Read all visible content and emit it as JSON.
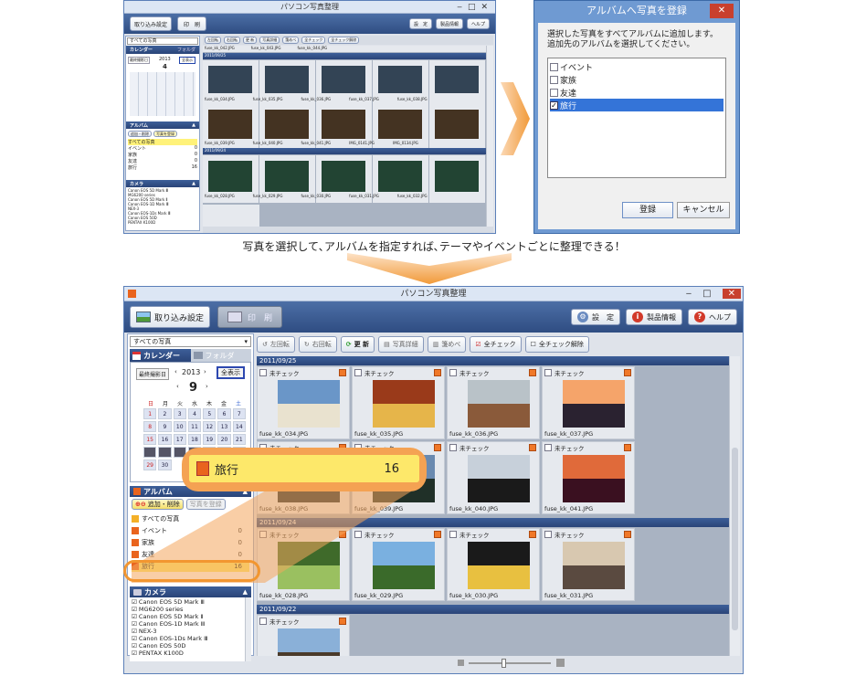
{
  "app": {
    "title": "パソコン写真整理",
    "import_label": "取り込み設定",
    "print_label": "印　刷",
    "settings_label": "設　定",
    "info_label": "製品情報",
    "help_label": "ヘルプ"
  },
  "toolbar": {
    "rotate_left": "左回転",
    "rotate_right": "右回転",
    "refresh": "更 新",
    "photo_detail": "写真詳細",
    "collect": "箋めべ",
    "check_all": "全チェック",
    "uncheck_all": "全チェック解除"
  },
  "sidebar": {
    "filter_value": "すべての写真",
    "tab_calendar": "カレンダー",
    "tab_folder": "フォルダ",
    "latest_date": "最終撮影日",
    "show_all": "全表示",
    "year": "2013",
    "month": "9",
    "weekdays": [
      "日",
      "月",
      "火",
      "水",
      "木",
      "金",
      "土"
    ],
    "small_month": "4"
  },
  "album": {
    "header": "アルバム",
    "add_delete": "追加・削除",
    "register": "写真を登録",
    "items": [
      {
        "label": "すべての写真",
        "count": ""
      },
      {
        "label": "イベント",
        "count": "0"
      },
      {
        "label": "家族",
        "count": "0"
      },
      {
        "label": "友達",
        "count": "0"
      },
      {
        "label": "旅行",
        "count": "16"
      }
    ]
  },
  "camera": {
    "header": "カメラ",
    "items": [
      "Canon EOS 5D Mark Ⅲ",
      "MG6200 series",
      "Canon EOS 5D Mark Ⅱ",
      "Canon EOS-1D Mark Ⅲ",
      "NEX-3",
      "Canon EOS-1Ds Mark Ⅲ",
      "Canon EOS 50D",
      "PENTAX K100D"
    ]
  },
  "callout": {
    "label": "旅行",
    "count": "16"
  },
  "dialog": {
    "title": "アルバムへ写真を登録",
    "message_line1": "選択した写真をすべてアルバムに追加します。",
    "message_line2": "追加先のアルバムを選択してください。",
    "options": [
      {
        "label": "イベント",
        "checked": false
      },
      {
        "label": "家族",
        "checked": false
      },
      {
        "label": "友達",
        "checked": false
      },
      {
        "label": "旅行",
        "checked": true
      }
    ],
    "ok": "登録",
    "cancel": "キャンセル"
  },
  "caption": "写真を選択して､アルバムを指定すれば､テーマやイベントごとに整理できる！",
  "groups": [
    {
      "date": "2011/09/25",
      "photos": [
        {
          "status": "未チェック",
          "file": "fuse_kk_034.JPG"
        },
        {
          "status": "未チェック",
          "file": "fuse_kk_035.JPG"
        },
        {
          "status": "未チェック",
          "file": "fuse_kk_036.JPG"
        },
        {
          "status": "未チェック",
          "file": "fuse_kk_037.JPG"
        },
        {
          "status": "未チェック",
          "file": "fuse_kk_038.JPG"
        },
        {
          "status": "未チェック",
          "file": "fuse_kk_039.JPG"
        },
        {
          "status": "未チェック",
          "file": "fuse_kk_040.JPG"
        },
        {
          "status": "未チェック",
          "file": "fuse_kk_041.JPG"
        }
      ]
    },
    {
      "date": "2011/09/24",
      "photos": [
        {
          "status": "未チェック",
          "file": "fuse_kk_028.JPG"
        },
        {
          "status": "未チェック",
          "file": "fuse_kk_029.JPG"
        },
        {
          "status": "未チェック",
          "file": "fuse_kk_030.JPG"
        },
        {
          "status": "未チェック",
          "file": "fuse_kk_031.JPG"
        }
      ]
    },
    {
      "date": "2011/09/22",
      "photos": [
        {
          "status": "未チェック",
          "file": ""
        }
      ]
    }
  ],
  "top_files": {
    "row0": [
      "fuse_kk_042.JPG",
      "fuse_kk_043.JPG",
      "fuse_kk_044.JPG"
    ],
    "date": "2011/09/25",
    "row1": [
      "fuse_kk_034.JPG",
      "fuse_kk_035.JPG",
      "fuse_kk_036.JPG",
      "fuse_kk_037.JPG",
      "fuse_kk_038.JPG"
    ],
    "row2": [
      "fuse_kk_039.JPG",
      "fuse_kk_040.JPG",
      "fuse_kk_041.JPG",
      "IMG_0141.JPG",
      "IMG_0134.JPG"
    ],
    "date2": "2011/09/24",
    "row3": [
      "fuse_kk_028.JPG",
      "fuse_kk_029.JPG",
      "fuse_kk_030.JPG",
      "fuse_kk_031.JPG",
      "fuse_kk_032.JPG"
    ]
  },
  "top_status": "未チェック"
}
